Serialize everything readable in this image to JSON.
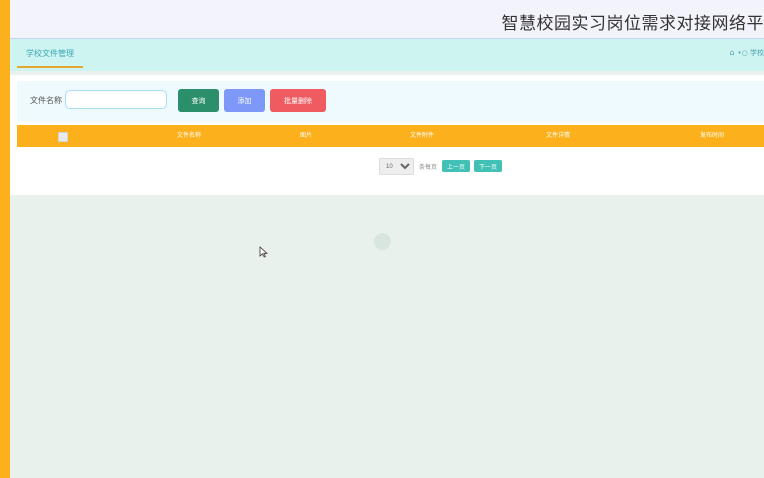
{
  "header": {
    "title": "智慧校园实习岗位需求对接网络平"
  },
  "tabs": [
    {
      "label": "学校文件管理",
      "active": true
    }
  ],
  "breadcrumb": {
    "home_icon": "home-icon",
    "separator": "•○",
    "current": "学校"
  },
  "search": {
    "label": "文件名称",
    "placeholder": "",
    "query_button": "查询",
    "add_button": "添加",
    "batch_delete_button": "批量删除"
  },
  "table": {
    "columns": [
      "文件名称",
      "图片",
      "文件附件",
      "文件详情",
      "发布时间"
    ],
    "rows": []
  },
  "pagination": {
    "page_size": "10",
    "page_size_options": [
      "10"
    ],
    "label": "条每页",
    "prev_label": "上一页",
    "next_label": "下一页"
  },
  "colors": {
    "accent": "#fbb01c",
    "tab_bar": "#cdf4f1",
    "query_button": "#2a8f6a",
    "add_button": "#7d98f6",
    "delete_button": "#ef5b60",
    "pager_button": "#41c0b5",
    "background": "#e8f1ec"
  }
}
